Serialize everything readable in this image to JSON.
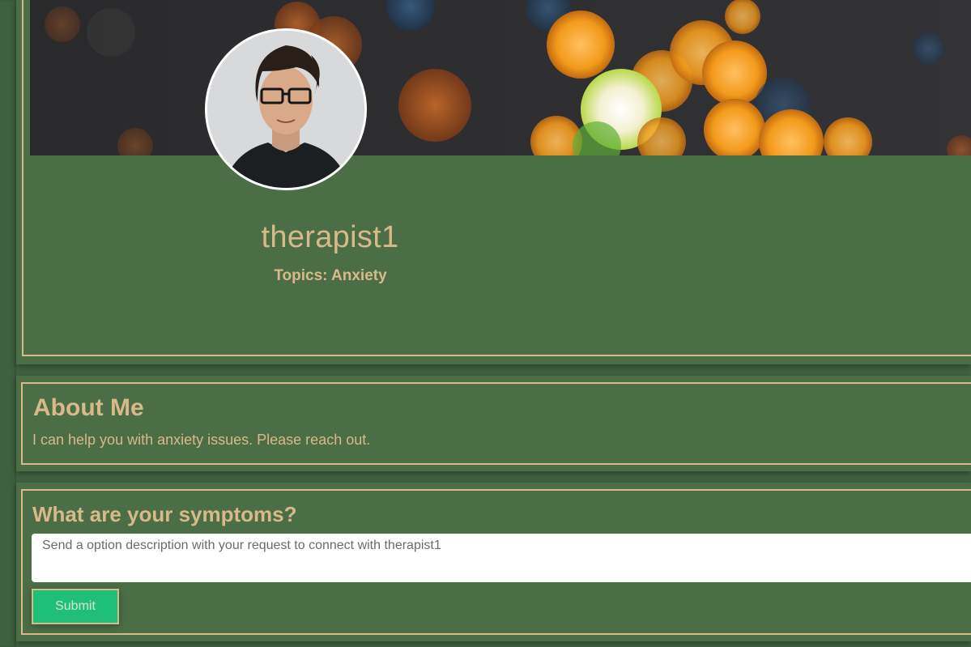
{
  "profile": {
    "username": "therapist1",
    "topics": "Topics: Anxiety",
    "avatar_alt": "therapist-portrait"
  },
  "about": {
    "title": "About Me",
    "text": "I can help you with anxiety issues. Please reach out."
  },
  "symptoms": {
    "title": "What are your symptoms?",
    "input_value": "",
    "input_placeholder": "Send a option description with your request to connect with therapist1",
    "submit_label": "Submit"
  },
  "colors": {
    "background": "#416342",
    "card": "#4b6e47",
    "accent": "#d8b98a",
    "submit": "#1fbf7a"
  }
}
